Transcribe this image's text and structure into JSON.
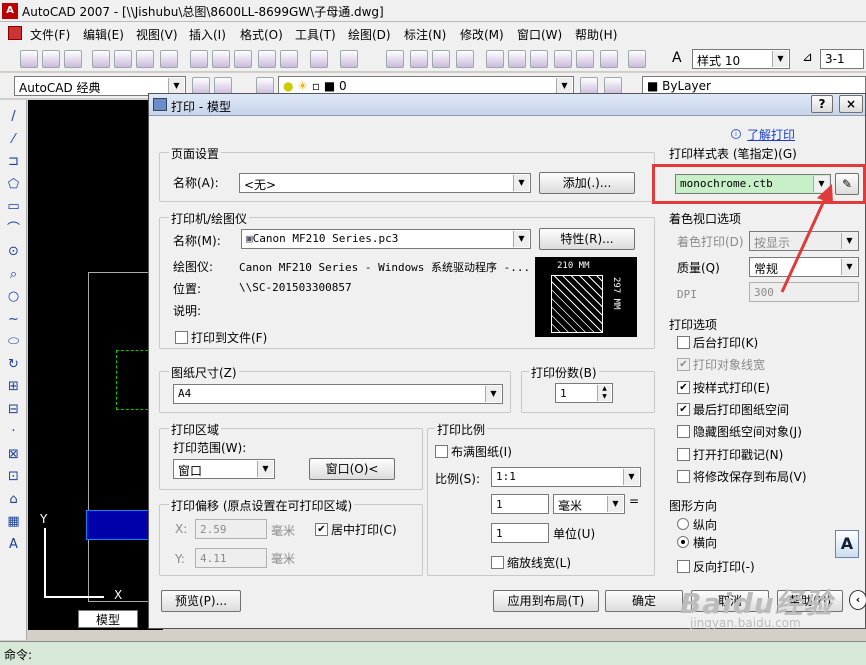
{
  "app": {
    "title": "AutoCAD 2007 - [\\\\Jishubu\\总图\\8600LL-8699GW\\子母通.dwg]",
    "logo": "A"
  },
  "menu": [
    "文件(F)",
    "编辑(E)",
    "视图(V)",
    "插入(I)",
    "格式(O)",
    "工具(T)",
    "绘图(D)",
    "标注(N)",
    "修改(M)",
    "窗口(W)",
    "帮助(H)"
  ],
  "toolbar": {
    "workspace": "AutoCAD 经典",
    "layer": "0",
    "style_label": "样式",
    "style_value": "10",
    "scale_value": "3-1",
    "linetype": "ByLayer"
  },
  "left_tools": [
    "/",
    "⁄",
    "⊐",
    "⬠",
    "▭",
    "⌒",
    "⊙",
    "⌕",
    "○",
    "∼",
    "⬭",
    "↻",
    "⊞",
    "⊟",
    "·",
    "⊠",
    "⊡",
    "⌂",
    "▦",
    "A"
  ],
  "canvas": {
    "tab": "模型",
    "axis_y": "Y",
    "axis_x": "X"
  },
  "command": {
    "prompt": "命令:"
  },
  "dialog": {
    "title": "打印 - 模型",
    "help_link": "了解打印",
    "page_setup": {
      "group": "页面设置",
      "name_label": "名称(A):",
      "name_value": "<无>",
      "add_button": "添加(.)..."
    },
    "printer": {
      "group": "打印机/绘图仪",
      "name_label": "名称(M):",
      "name_value": "Canon MF210 Series.pc3",
      "properties_button": "特性(R)...",
      "plotter_label": "绘图仪:",
      "plotter_value": "Canon MF210 Series - Windows 系统驱动程序 -...",
      "location_label": "位置:",
      "location_value": "\\\\SC-201503300857",
      "desc_label": "说明:",
      "print_to_file": "打印到文件(F)",
      "dim_width": "210 MM",
      "dim_height": "297 MM"
    },
    "paper_size": {
      "group": "图纸尺寸(Z)",
      "value": "A4"
    },
    "copies": {
      "group": "打印份数(B)",
      "value": "1"
    },
    "plot_area": {
      "group": "打印区域",
      "range_label": "打印范围(W):",
      "range_value": "窗口",
      "window_button": "窗口(O)<"
    },
    "plot_offset": {
      "group": "打印偏移 (原点设置在可打印区域)",
      "x_label": "X:",
      "x_value": "2.59",
      "y_label": "Y:",
      "y_value": "4.11",
      "unit": "毫米",
      "center_label": "居中打印(C)"
    },
    "plot_scale": {
      "group": "打印比例",
      "fit_paper": "布满图纸(I)",
      "scale_label": "比例(S):",
      "scale_value": "1:1",
      "value1": "1",
      "unit_value": "毫米",
      "value2": "1",
      "unit_label": "单位(U)",
      "scale_lineweights": "缩放线宽(L)"
    },
    "style_table": {
      "group": "打印样式表 (笔指定)(G)",
      "value": "monochrome.ctb"
    },
    "shaded_viewport": {
      "group": "着色视口选项",
      "shade_label": "着色打印(D)",
      "shade_value": "按显示",
      "quality_label": "质量(Q)",
      "quality_value": "常规",
      "dpi_label": "DPI",
      "dpi_value": "300"
    },
    "plot_options": {
      "group": "打印选项",
      "items": [
        {
          "label": "后台打印(K)",
          "checked": false,
          "disabled": false
        },
        {
          "label": "打印对象线宽",
          "checked": true,
          "disabled": true
        },
        {
          "label": "按样式打印(E)",
          "checked": true,
          "disabled": false
        },
        {
          "label": "最后打印图纸空间",
          "checked": true,
          "disabled": false
        },
        {
          "label": "隐藏图纸空间对象(J)",
          "checked": false,
          "disabled": false
        },
        {
          "label": "打开打印戳记(N)",
          "checked": false,
          "disabled": false
        },
        {
          "label": "将修改保存到布局(V)",
          "checked": false,
          "disabled": false
        }
      ]
    },
    "orientation": {
      "group": "图形方向",
      "portrait": "纵向",
      "landscape": "横向",
      "reverse": "反向打印(-)",
      "icon": "A"
    },
    "buttons": {
      "preview": "预览(P)...",
      "apply": "应用到布局(T)",
      "ok": "确定",
      "cancel": "取消",
      "help": "帮助(H)"
    }
  },
  "watermark": {
    "text": "Baidu经验",
    "url": "jingyan.baidu.com"
  },
  "colors": {
    "highlight": "#e03a3a",
    "selected_field": "#c8f0c8"
  }
}
